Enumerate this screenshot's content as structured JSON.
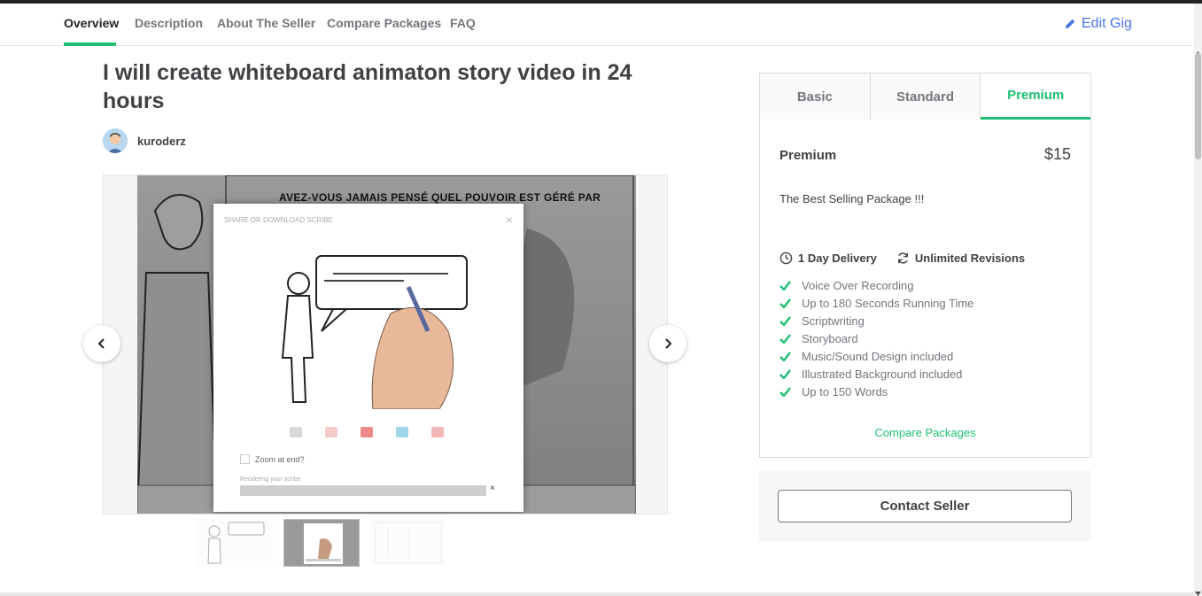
{
  "nav": {
    "tabs": [
      "Overview",
      "Description",
      "About The Seller",
      "Compare Packages",
      "FAQ"
    ],
    "edit_gig": "Edit Gig"
  },
  "gig": {
    "title": "I will create whiteboard animaton story video in 24 hours",
    "seller": "kuroderz"
  },
  "gallery": {
    "slide_caption": "AVEZ-VOUS JAMAIS PENSÉ QUEL POUVOIR EST GÉRÉ PAR",
    "modal_title": "SHARE OR DOWNLOAD SCRIBE",
    "modal_close": "×",
    "zoom_label": "Zoom at end?",
    "rendering_label": "Rendering your scribe",
    "rendering_close": "×"
  },
  "package": {
    "tabs": [
      "Basic",
      "Standard",
      "Premium"
    ],
    "active_tab": "Premium",
    "name": "Premium",
    "price": "$15",
    "description": "The Best Selling Package !!!",
    "delivery": "1 Day Delivery",
    "revisions": "Unlimited Revisions",
    "features": [
      "Voice Over Recording",
      "Up to 180 Seconds Running Time",
      "Scriptwriting",
      "Storyboard",
      "Music/Sound Design included",
      "Illustrated Background included",
      "Up to 150 Words"
    ],
    "compare_link": "Compare Packages",
    "contact_button": "Contact Seller"
  },
  "colors": {
    "accent_green": "#1dbf73",
    "link_blue": "#4a73e8",
    "text_dark": "#404145",
    "text_muted": "#74767e"
  }
}
